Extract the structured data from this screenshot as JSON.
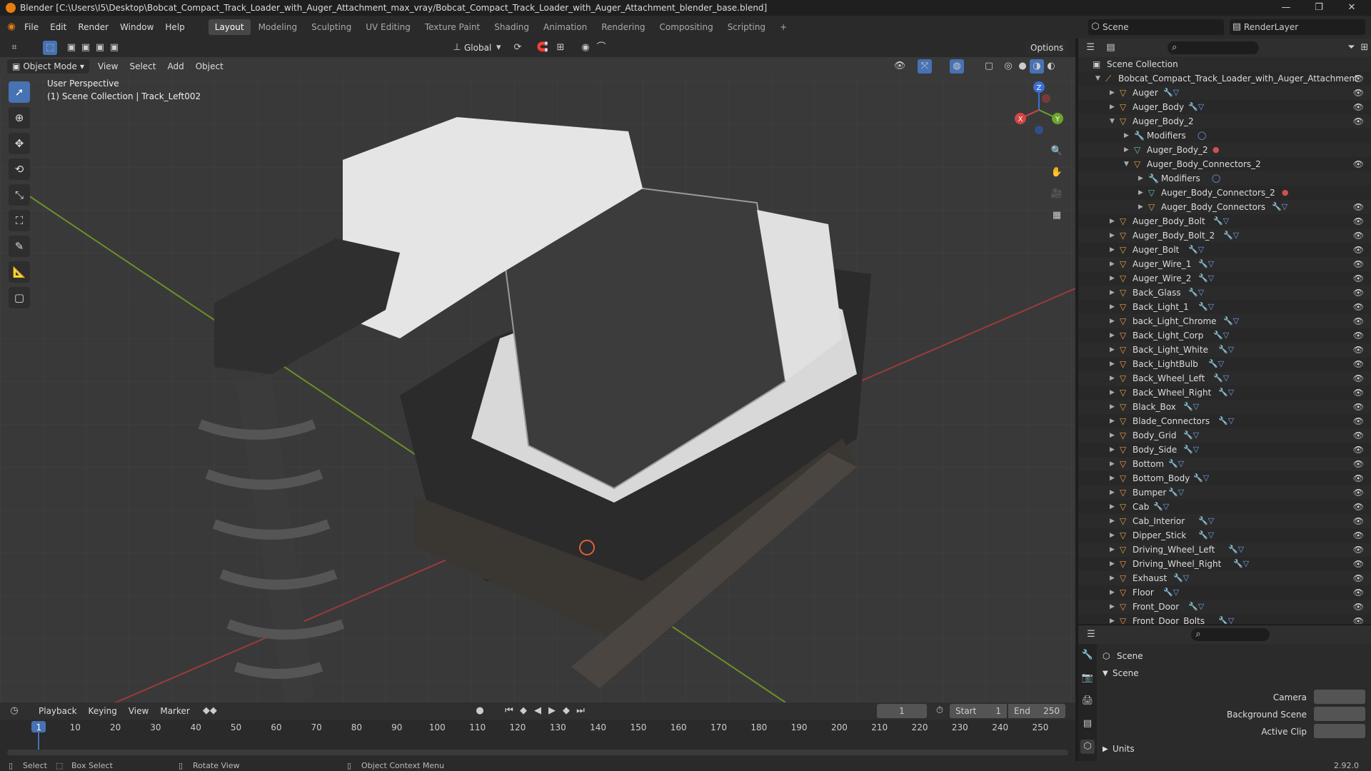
{
  "window": {
    "title": "Blender [C:\\Users\\I5\\Desktop\\Bobcat_Compact_Track_Loader_with_Auger_Attachment_max_vray/Bobcat_Compact_Track_Loader_with_Auger_Attachment_blender_base.blend]",
    "minimize": "—",
    "maximize": "❐",
    "close": "✕"
  },
  "menu": [
    "File",
    "Edit",
    "Render",
    "Window",
    "Help"
  ],
  "workspaces": [
    "Layout",
    "Modeling",
    "Sculpting",
    "UV Editing",
    "Texture Paint",
    "Shading",
    "Animation",
    "Rendering",
    "Compositing",
    "Scripting"
  ],
  "workspace_add": "+",
  "scene": {
    "label": "Scene",
    "layer": "RenderLayer"
  },
  "viewport": {
    "orientation": "Global",
    "options": "Options",
    "mode": "Object Mode",
    "menus": [
      "View",
      "Select",
      "Add",
      "Object"
    ],
    "perspective": "User Perspective",
    "collection": "(1) Scene Collection | Track_Left002",
    "gizmo": {
      "z": "Z",
      "y": "Y",
      "x": "X"
    }
  },
  "outliner": {
    "root": "Scene Collection",
    "items": [
      {
        "name": "Bobcat_Compact_Track_Loader_with_Auger_Attachment",
        "depth": 0,
        "open": true,
        "type": "collection",
        "mods": ""
      },
      {
        "name": "Auger",
        "depth": 1,
        "open": false,
        "type": "mesh",
        "mods": "🔧▽"
      },
      {
        "name": "Auger_Body",
        "depth": 1,
        "open": false,
        "type": "mesh",
        "mods": "🔧▽"
      },
      {
        "name": "Auger_Body_2",
        "depth": 1,
        "open": true,
        "type": "mesh",
        "mods": ""
      },
      {
        "name": "Modifiers",
        "depth": 2,
        "open": false,
        "type": "mod",
        "mods": "◯"
      },
      {
        "name": "Auger_Body_2",
        "depth": 2,
        "open": false,
        "type": "data",
        "mods": "●"
      },
      {
        "name": "Auger_Body_Connectors_2",
        "depth": 2,
        "open": true,
        "type": "mesh",
        "mods": ""
      },
      {
        "name": "Modifiers",
        "depth": 3,
        "open": false,
        "type": "mod",
        "mods": "◯"
      },
      {
        "name": "Auger_Body_Connectors_2",
        "depth": 3,
        "open": false,
        "type": "data",
        "mods": "●"
      },
      {
        "name": "Auger_Body_Connectors",
        "depth": 3,
        "open": false,
        "type": "mesh",
        "mods": "🔧▽"
      },
      {
        "name": "Auger_Body_Bolt",
        "depth": 1,
        "open": false,
        "type": "mesh",
        "mods": "🔧▽"
      },
      {
        "name": "Auger_Body_Bolt_2",
        "depth": 1,
        "open": false,
        "type": "mesh",
        "mods": "🔧▽"
      },
      {
        "name": "Auger_Bolt",
        "depth": 1,
        "open": false,
        "type": "mesh",
        "mods": "🔧▽"
      },
      {
        "name": "Auger_Wire_1",
        "depth": 1,
        "open": false,
        "type": "mesh",
        "mods": "🔧▽"
      },
      {
        "name": "Auger_Wire_2",
        "depth": 1,
        "open": false,
        "type": "mesh",
        "mods": "🔧▽"
      },
      {
        "name": "Back_Glass",
        "depth": 1,
        "open": false,
        "type": "mesh",
        "mods": "🔧▽"
      },
      {
        "name": "Back_Light_1",
        "depth": 1,
        "open": false,
        "type": "mesh",
        "mods": "🔧▽"
      },
      {
        "name": "back_Light_Chrome",
        "depth": 1,
        "open": false,
        "type": "mesh",
        "mods": "🔧▽"
      },
      {
        "name": "Back_Light_Corp",
        "depth": 1,
        "open": false,
        "type": "mesh",
        "mods": "🔧▽"
      },
      {
        "name": "Back_Light_White",
        "depth": 1,
        "open": false,
        "type": "mesh",
        "mods": "🔧▽"
      },
      {
        "name": "Back_LightBulb",
        "depth": 1,
        "open": false,
        "type": "mesh",
        "mods": "🔧▽"
      },
      {
        "name": "Back_Wheel_Left",
        "depth": 1,
        "open": false,
        "type": "mesh",
        "mods": "🔧▽"
      },
      {
        "name": "Back_Wheel_Right",
        "depth": 1,
        "open": false,
        "type": "mesh",
        "mods": "🔧▽"
      },
      {
        "name": "Black_Box",
        "depth": 1,
        "open": false,
        "type": "mesh",
        "mods": "🔧▽"
      },
      {
        "name": "Blade_Connectors",
        "depth": 1,
        "open": false,
        "type": "mesh",
        "mods": "🔧▽"
      },
      {
        "name": "Body_Grid",
        "depth": 1,
        "open": false,
        "type": "mesh",
        "mods": "🔧▽"
      },
      {
        "name": "Body_Side",
        "depth": 1,
        "open": false,
        "type": "mesh",
        "mods": "🔧▽"
      },
      {
        "name": "Bottom",
        "depth": 1,
        "open": false,
        "type": "mesh",
        "mods": "🔧▽"
      },
      {
        "name": "Bottom_Body",
        "depth": 1,
        "open": false,
        "type": "mesh",
        "mods": "🔧▽"
      },
      {
        "name": "Bumper",
        "depth": 1,
        "open": false,
        "type": "mesh",
        "mods": "🔧▽"
      },
      {
        "name": "Cab",
        "depth": 1,
        "open": false,
        "type": "mesh",
        "mods": "🔧▽"
      },
      {
        "name": "Cab_Interior",
        "depth": 1,
        "open": false,
        "type": "mesh",
        "mods": "🔧▽"
      },
      {
        "name": "Dipper_Stick",
        "depth": 1,
        "open": false,
        "type": "mesh",
        "mods": "🔧▽"
      },
      {
        "name": "Driving_Wheel_Left",
        "depth": 1,
        "open": false,
        "type": "mesh",
        "mods": "🔧▽"
      },
      {
        "name": "Driving_Wheel_Right",
        "depth": 1,
        "open": false,
        "type": "mesh",
        "mods": "🔧▽"
      },
      {
        "name": "Exhaust",
        "depth": 1,
        "open": false,
        "type": "mesh",
        "mods": "🔧▽"
      },
      {
        "name": "Floor",
        "depth": 1,
        "open": false,
        "type": "mesh",
        "mods": "🔧▽"
      },
      {
        "name": "Front_Door",
        "depth": 1,
        "open": false,
        "type": "mesh",
        "mods": "🔧▽"
      },
      {
        "name": "Front_Door_Bolts",
        "depth": 1,
        "open": false,
        "type": "mesh",
        "mods": "🔧▽"
      }
    ]
  },
  "properties": {
    "header": "Scene",
    "section": "Scene",
    "camera_label": "Camera",
    "bg_scene_label": "Background Scene",
    "active_clip_label": "Active Clip",
    "units_label": "Units"
  },
  "timeline": {
    "menus": [
      "Playback",
      "Keying",
      "View",
      "Marker"
    ],
    "current_frame": "1",
    "start_label": "Start",
    "start": "1",
    "end_label": "End",
    "end": "250",
    "ticks": [
      "1",
      "10",
      "20",
      "30",
      "40",
      "50",
      "60",
      "70",
      "80",
      "90",
      "100",
      "110",
      "120",
      "130",
      "140",
      "150",
      "160",
      "170",
      "180",
      "190",
      "200",
      "210",
      "220",
      "230",
      "240",
      "250"
    ]
  },
  "status": {
    "select": "Select",
    "box_select": "Box Select",
    "rotate": "Rotate View",
    "context": "Object Context Menu",
    "version": "2.92.0"
  }
}
